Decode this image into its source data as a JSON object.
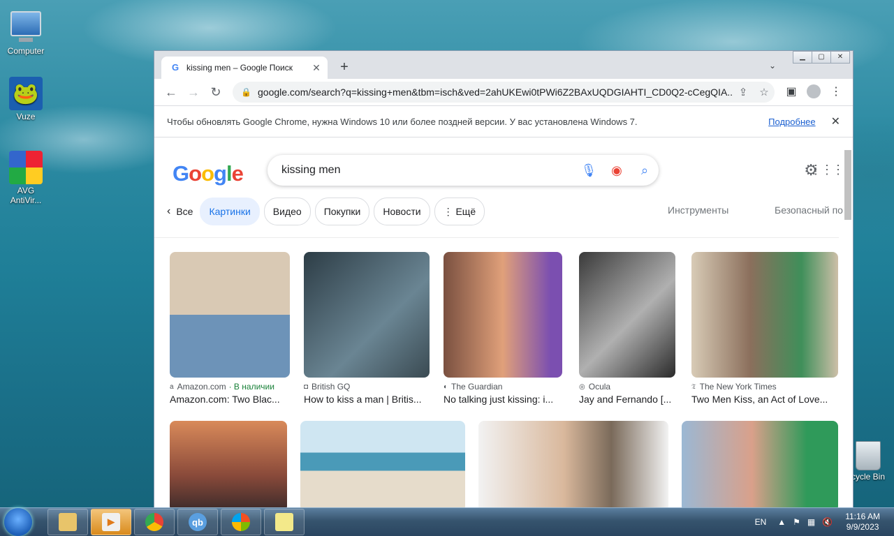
{
  "desktop": {
    "icons": [
      {
        "label": "Computer"
      },
      {
        "label": "Vuze"
      },
      {
        "label": "AVG\nAntiVir..."
      },
      {
        "label": "cycle Bin"
      }
    ]
  },
  "browser": {
    "tab_title": "kissing men – Google Поиск",
    "url": "google.com/search?q=kissing+men&tbm=isch&ved=2ahUKEwi0tPWi6Z2BAxUQDGIAHTI_CD0Q2-cCegQIA...",
    "infobar": {
      "message": "Чтобы обновлять Google Chrome, нужна Windows 10 или более поздней версии. У вас установлена Windows 7.",
      "link": "Подробнее"
    }
  },
  "google": {
    "logo": "Google",
    "query": "kissing men",
    "back_label": "Все",
    "chips": [
      "Картинки",
      "Видео",
      "Покупки",
      "Новости",
      "Ещё"
    ],
    "tools": "Инструменты",
    "safe_search": "Безопасный по"
  },
  "results": [
    {
      "source": "Amazon.com",
      "instock": "· В наличии",
      "caption": "Amazon.com: Two Blac...",
      "color": "#b7c7d4"
    },
    {
      "source": "British GQ",
      "instock": "",
      "caption": "How to kiss a man | Britis...",
      "color": "#3a4a52"
    },
    {
      "source": "The Guardian",
      "instock": "",
      "caption": "No talking just kissing: i...",
      "color": "#c98e6a"
    },
    {
      "source": "Ocula",
      "instock": "",
      "caption": "Jay and Fernando [...",
      "color": "#6b6b6b"
    },
    {
      "source": "The New York Times",
      "instock": "",
      "caption": "Two Men Kiss, an Act of Love...",
      "color": "#a89a84"
    }
  ],
  "taskbar": {
    "language": "EN",
    "time": "11:16 AM",
    "date": "9/9/2023"
  }
}
